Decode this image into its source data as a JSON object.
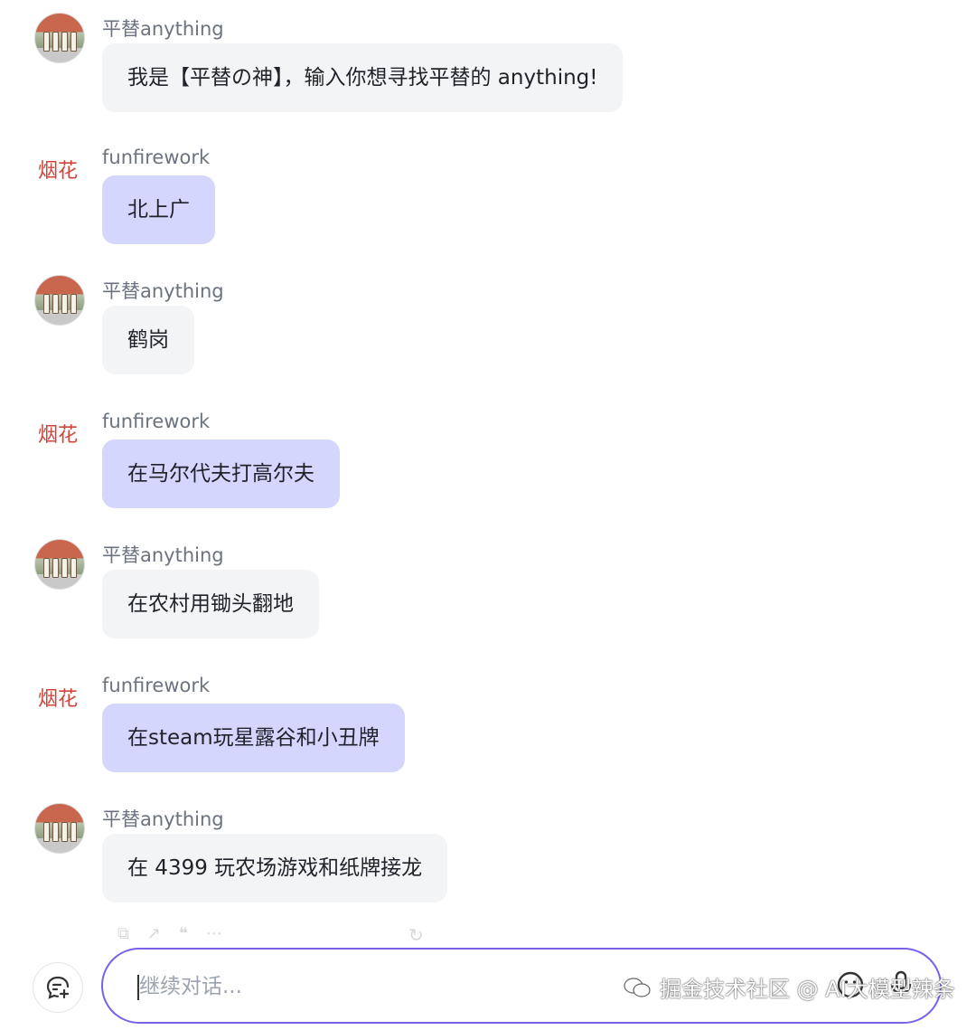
{
  "messages": [
    {
      "sender": "平替anything",
      "role": "bot",
      "text": "我是【平替の神】，输入你想寻找平替的 anything!"
    },
    {
      "sender": "funfirework",
      "role": "user",
      "text": "北上广"
    },
    {
      "sender": "平替anything",
      "role": "bot",
      "text": "鹤岗"
    },
    {
      "sender": "funfirework",
      "role": "user",
      "text": "在马尔代夫打高尔夫"
    },
    {
      "sender": "平替anything",
      "role": "bot",
      "text": "在农村用锄头翻地"
    },
    {
      "sender": "funfirework",
      "role": "user",
      "text": "在steam玩星露谷和小丑牌"
    },
    {
      "sender": "平替anything",
      "role": "bot",
      "text": "在 4399 玩农场游戏和纸牌接龙"
    }
  ],
  "avatar_text": {
    "user": "烟花"
  },
  "composer": {
    "placeholder": "继续对话..."
  },
  "watermark": {
    "text": "掘金技术社区 @ AI大模型辣条"
  },
  "colors": {
    "bot_bubble": "#f3f4f6",
    "user_bubble": "#d4d6fe",
    "input_border": "#7b61e8",
    "sender_text": "#6b7280"
  },
  "icons": [
    "copy-icon",
    "share-icon",
    "quote-icon",
    "more-icon",
    "regenerate-icon",
    "new-chat-icon",
    "emoji-icon",
    "mic-icon",
    "wechat-icon"
  ]
}
